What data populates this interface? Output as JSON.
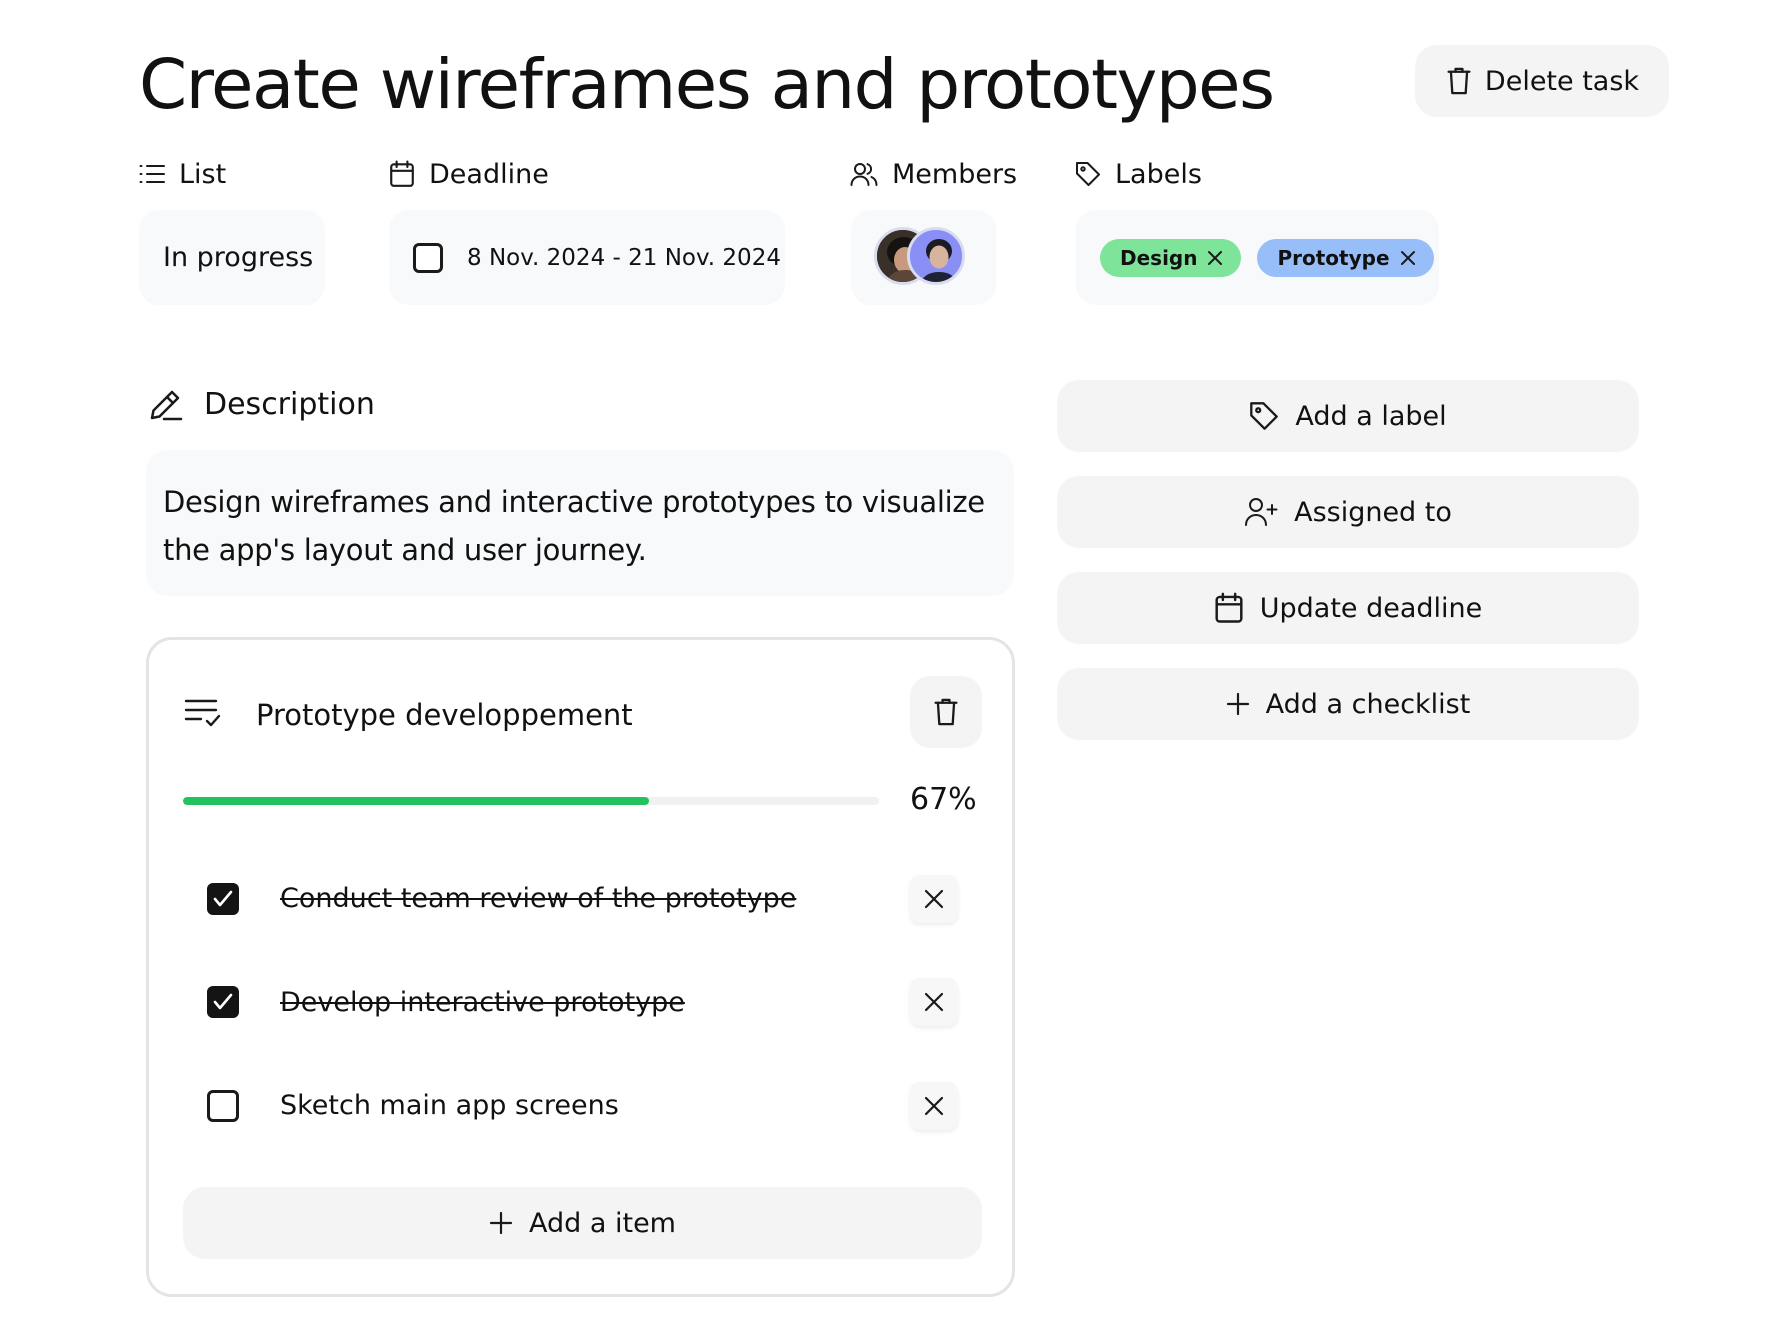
{
  "task": {
    "title": "Create wireframes and prototypes",
    "delete_label": "Delete task"
  },
  "meta": {
    "list": {
      "label": "List",
      "value": "In progress",
      "icon": "list-icon"
    },
    "deadline": {
      "label": "Deadline",
      "value": "8 Nov. 2024 - 21 Nov. 2024",
      "icon": "calendar-icon",
      "done": false
    },
    "members": {
      "label": "Members",
      "icon": "users-icon",
      "count": 2
    },
    "labels": {
      "label": "Labels",
      "icon": "tag-icon",
      "items": [
        {
          "text": "Design",
          "color": "#7ee49a"
        },
        {
          "text": "Prototype",
          "color": "#98befa"
        }
      ]
    }
  },
  "description": {
    "heading": "Description",
    "text": "Design wireframes and interactive prototypes to visualize the app's layout and user journey."
  },
  "actions": {
    "add_label": "Add a label",
    "assigned_to": "Assigned to",
    "update_deadline": "Update deadline",
    "add_checklist": "Add a checklist"
  },
  "checklist": {
    "title": "Prototype developpement",
    "progress": 0.67,
    "progress_text": "67%",
    "progress_color": "#22c35e",
    "items": [
      {
        "text": "Conduct team review of the prototype",
        "checked": true
      },
      {
        "text": "Develop interactive prototype",
        "checked": true
      },
      {
        "text": "Sketch main app screens",
        "checked": false
      }
    ],
    "add_item_label": "Add a item"
  }
}
